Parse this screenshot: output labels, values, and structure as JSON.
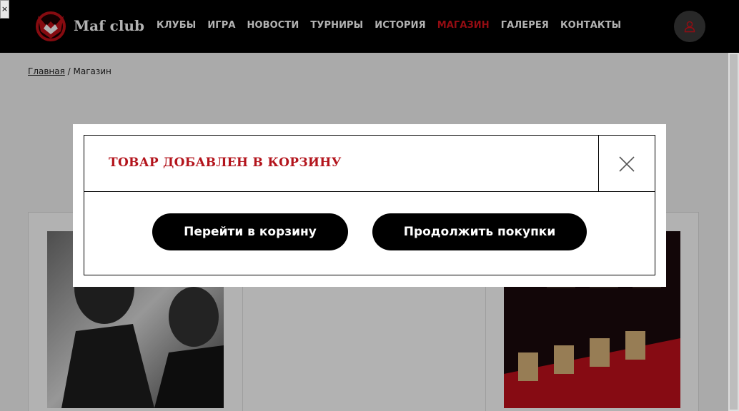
{
  "window": {
    "close_label": "×"
  },
  "header": {
    "brand": "Maf club",
    "nav": [
      {
        "label": "КЛУБЫ",
        "active": false
      },
      {
        "label": "ИГРА",
        "active": false
      },
      {
        "label": "НОВОСТИ",
        "active": false
      },
      {
        "label": "ТУРНИРЫ",
        "active": false
      },
      {
        "label": "ИСТОРИЯ",
        "active": false
      },
      {
        "label": "МАГАЗИН",
        "active": true
      },
      {
        "label": "ГАЛЕРЕЯ",
        "active": false
      },
      {
        "label": "КОНТАКТЫ",
        "active": false
      }
    ],
    "profile_icon": "user-icon",
    "accent_color": "#d5121b"
  },
  "breadcrumb": {
    "home": "Главная",
    "separator": " / ",
    "current": "Магазин"
  },
  "modal": {
    "title": "ТОВАР ДОБАВЛЕН В КОРЗИНУ",
    "close_icon": "close-icon",
    "go_to_cart_label": "Перейти в корзину",
    "continue_label": "Продолжить покупки",
    "title_color": "#b3141c"
  }
}
